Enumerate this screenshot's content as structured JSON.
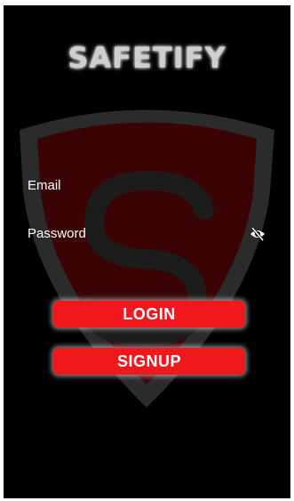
{
  "app": {
    "title": "SAFETIFY"
  },
  "form": {
    "email_label": "Email",
    "password_label": "Password",
    "password_toggle_icon": "eye-slash-icon"
  },
  "buttons": {
    "login_label": "LOGIN",
    "signup_label": "SIGNUP"
  },
  "colors": {
    "background": "#000000",
    "button": "#f0181c",
    "shield_outer": "#2b2b2b",
    "shield_inner": "#3a0404"
  }
}
